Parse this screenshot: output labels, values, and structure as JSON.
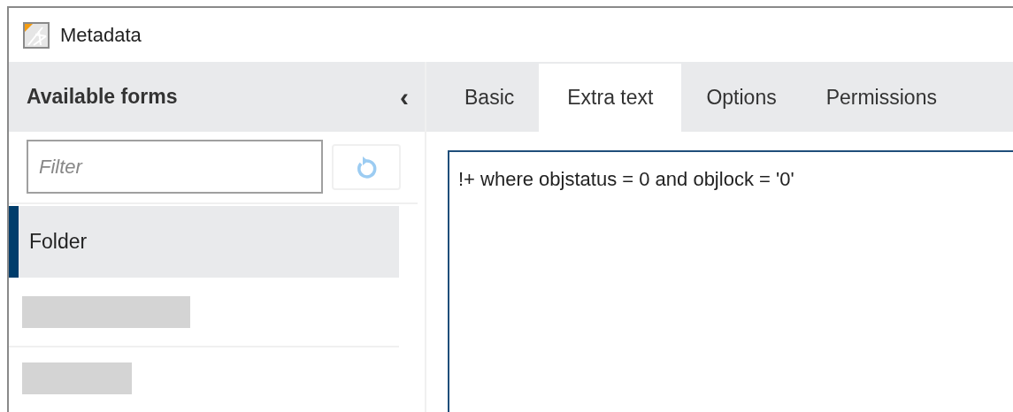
{
  "window": {
    "title": "Metadata"
  },
  "sidebar": {
    "title": "Available forms",
    "collapse_icon": "‹",
    "filter": {
      "placeholder": "Filter"
    },
    "items": [
      {
        "kind": "item",
        "label": "Folder",
        "selected": true
      },
      {
        "kind": "loading",
        "selected": false
      },
      {
        "kind": "loading",
        "selected": false
      }
    ]
  },
  "tabs": [
    {
      "label": "Basic",
      "selected": false
    },
    {
      "label": "Extra text",
      "selected": true
    },
    {
      "label": "Options",
      "selected": false
    },
    {
      "label": "Permissions",
      "selected": false
    }
  ],
  "editor": {
    "value": "!+ where objstatus = 0 and objlock = '0'"
  }
}
